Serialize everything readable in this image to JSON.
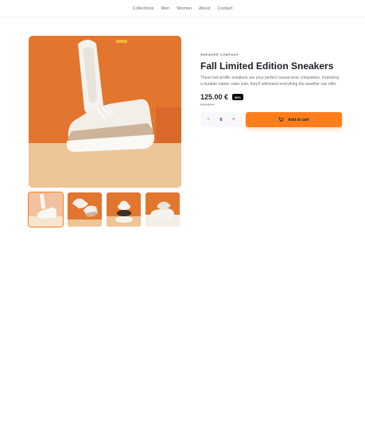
{
  "nav": {
    "items": [
      "Collections",
      "Men",
      "Women",
      "About",
      "Contact"
    ]
  },
  "product": {
    "company": "SNEAKER COMPANY",
    "title": "Fall Limited Edition Sneakers",
    "description": "These low-profile sneakers are your perfect casual wear companion. Featuring a durable rubber outer sole, they'll withstand everything the weather can offer.",
    "price": "125.00 €",
    "discount": "50%",
    "old_price": "250.00 €"
  },
  "quantity": {
    "minus": "−",
    "value": "0",
    "plus": "+"
  },
  "cart": {
    "label": "Add to cart",
    "icon": "cart-icon"
  },
  "gallery": {
    "thumbnail_count": 4,
    "active_thumbnail": 1
  },
  "colors": {
    "accent": "#ff7e1b",
    "background_orange": "#e2762f",
    "text_dark": "#1d2026",
    "text_muted": "#69707d"
  }
}
